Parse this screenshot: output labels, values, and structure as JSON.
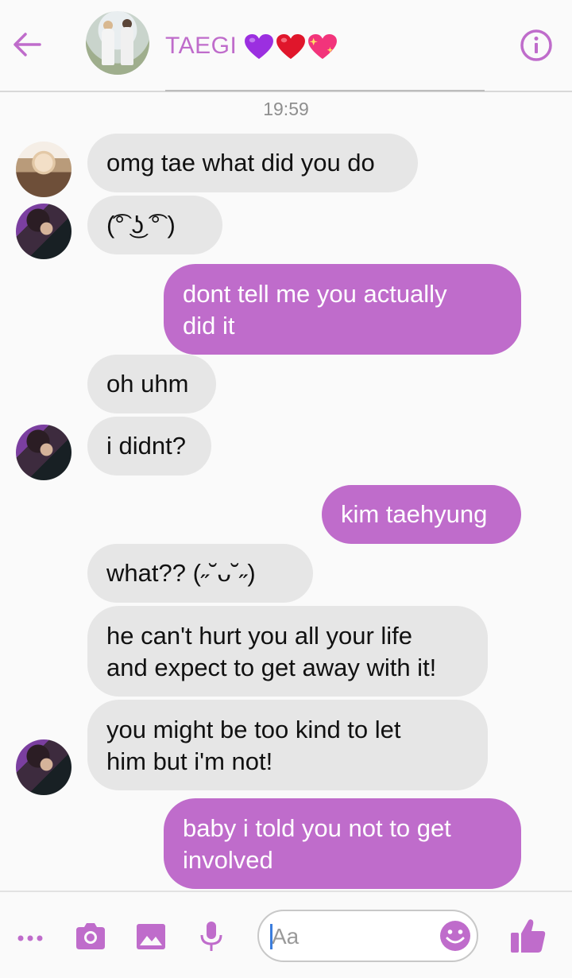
{
  "header": {
    "title": "TAEGI",
    "title_emojis": [
      "purple-heart",
      "red-heart",
      "sparkling-heart"
    ],
    "back_icon": "arrow-left-icon",
    "info_icon": "info-icon"
  },
  "conversation": {
    "timestamp": "19:59",
    "messages": [
      {
        "direction": "in",
        "sender_avatar": "yoongi",
        "text": "omg tae what did you do"
      },
      {
        "direction": "in",
        "sender_avatar": "taehyung",
        "text": "(͡° ͜ʖ ͡° )"
      },
      {
        "direction": "out",
        "lines": [
          "dont tell me you actually",
          "did it"
        ]
      },
      {
        "direction": "in",
        "text": "oh uhm"
      },
      {
        "direction": "in",
        "sender_avatar": "taehyung",
        "text": "i didnt?"
      },
      {
        "direction": "out",
        "text": "kim taehyung"
      },
      {
        "direction": "in",
        "text": "what?? (˶˘ᴗ˘˶)"
      },
      {
        "direction": "in",
        "lines": [
          "he can't hurt you all your life",
          "and expect to get away with it!"
        ]
      },
      {
        "direction": "in",
        "sender_avatar": "taehyung",
        "lines": [
          "you might be too kind to let",
          "him but i'm not!"
        ]
      },
      {
        "direction": "out",
        "lines": [
          "baby i told you not to get",
          "involved"
        ]
      }
    ]
  },
  "composer": {
    "placeholder": "Aa",
    "icons": [
      "more-icon",
      "camera-icon",
      "image-icon",
      "microphone-icon",
      "emoji-icon",
      "thumbs-up-icon"
    ]
  },
  "colors": {
    "accent": "#bf6ccb",
    "incoming_bubble": "#e6e6e6",
    "background": "#fafafa"
  }
}
